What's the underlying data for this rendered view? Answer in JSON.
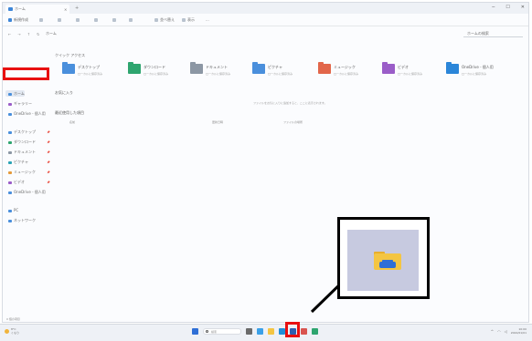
{
  "window": {
    "tab_title": "ホーム",
    "toolbar": {
      "new_label": "新規作成",
      "sort_label": "並べ替え",
      "view_label": "表示",
      "more_label": "..."
    },
    "address": "ホーム",
    "search_placeholder": "ホームの検索"
  },
  "sidebar": {
    "home_label": "ホーム",
    "gallery_label": "ギャラリー",
    "highlight_label": "OneDrive - 個人用",
    "items": [
      {
        "label": "デスクトップ",
        "icon": "desktop-icon"
      },
      {
        "label": "ダウンロード",
        "icon": "download-icon"
      },
      {
        "label": "ドキュメント",
        "icon": "documents-icon"
      },
      {
        "label": "ピクチャ",
        "icon": "pictures-icon"
      },
      {
        "label": "ミュージック",
        "icon": "music-icon"
      },
      {
        "label": "ビデオ",
        "icon": "videos-icon"
      },
      {
        "label": "OneDrive - 個人用",
        "icon": "onedrive-icon"
      }
    ],
    "bottom": [
      {
        "label": "PC",
        "icon": "pc-icon"
      },
      {
        "label": "ネットワーク",
        "icon": "network-icon"
      }
    ]
  },
  "content": {
    "quick_access_label": "クイック アクセス",
    "folders": [
      {
        "name": "デスクトップ",
        "sub": "ローカルに保存済み",
        "color": "#4a8fdc"
      },
      {
        "name": "ダウンロード",
        "sub": "ローカルに保存済み",
        "color": "#2ea56f"
      },
      {
        "name": "ドキュメント",
        "sub": "ローカルに保存済み",
        "color": "#8c97a4"
      },
      {
        "name": "ピクチャ",
        "sub": "ローカルに保存済み",
        "color": "#4a8fdc"
      },
      {
        "name": "ミュージック",
        "sub": "ローカルに保存済み",
        "color": "#e2664a"
      },
      {
        "name": "ビデオ",
        "sub": "ローカルに保存済み",
        "color": "#9a5dc8"
      },
      {
        "name": "OneDrive - 個人用",
        "sub": "ローカルに保存済み",
        "color": "#2b86d9"
      }
    ],
    "favorites_label": "お気に入り",
    "empty_message": "ファイルをお気に入りに追加すると、ここに表示されます。",
    "recent_label": "最近使用した項目",
    "columns": [
      "名前",
      "更新日時",
      "ファイルの場所"
    ]
  },
  "status": "0 個の項目",
  "taskbar": {
    "weather_temp": "8°C",
    "weather_desc": "くもり",
    "search_label": "検索",
    "time": "10:00",
    "date": "2024/01/01"
  },
  "colors": {
    "highlight": "#e81010",
    "accent": "#3d86d8",
    "folder_yellow": "#f4c542",
    "folder_blue": "#2f6fd6"
  }
}
